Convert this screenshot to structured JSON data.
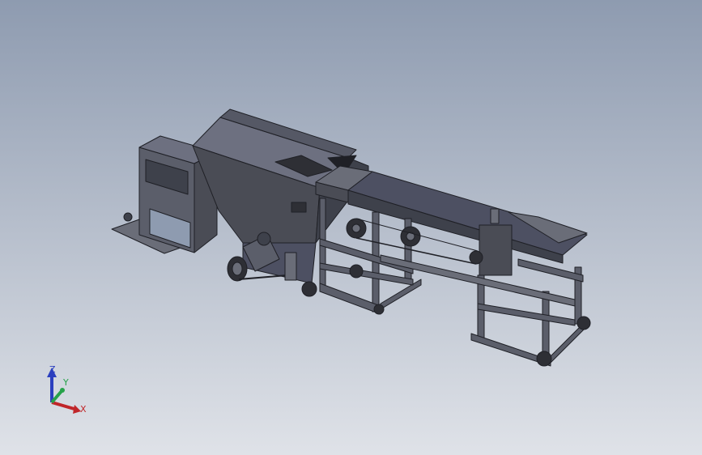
{
  "app": {
    "view": "isometric",
    "background_top": "#8e9bb0",
    "background_bottom": "#d9dde4"
  },
  "model": {
    "icon": "cad-assembly-icon",
    "colors": {
      "frame": "#5b5e6a",
      "frame_dark": "#3e414b",
      "plate": "#4a4c55",
      "plate_light": "#6a6d78",
      "conveyor_top": "#4d5062",
      "wheel": "#2e2f35"
    }
  },
  "triad": {
    "x_label": "X",
    "y_label": "Y",
    "z_label": "Z",
    "x_color": "#c0262a",
    "y_color": "#27a24a",
    "z_color": "#2b3fbf"
  }
}
